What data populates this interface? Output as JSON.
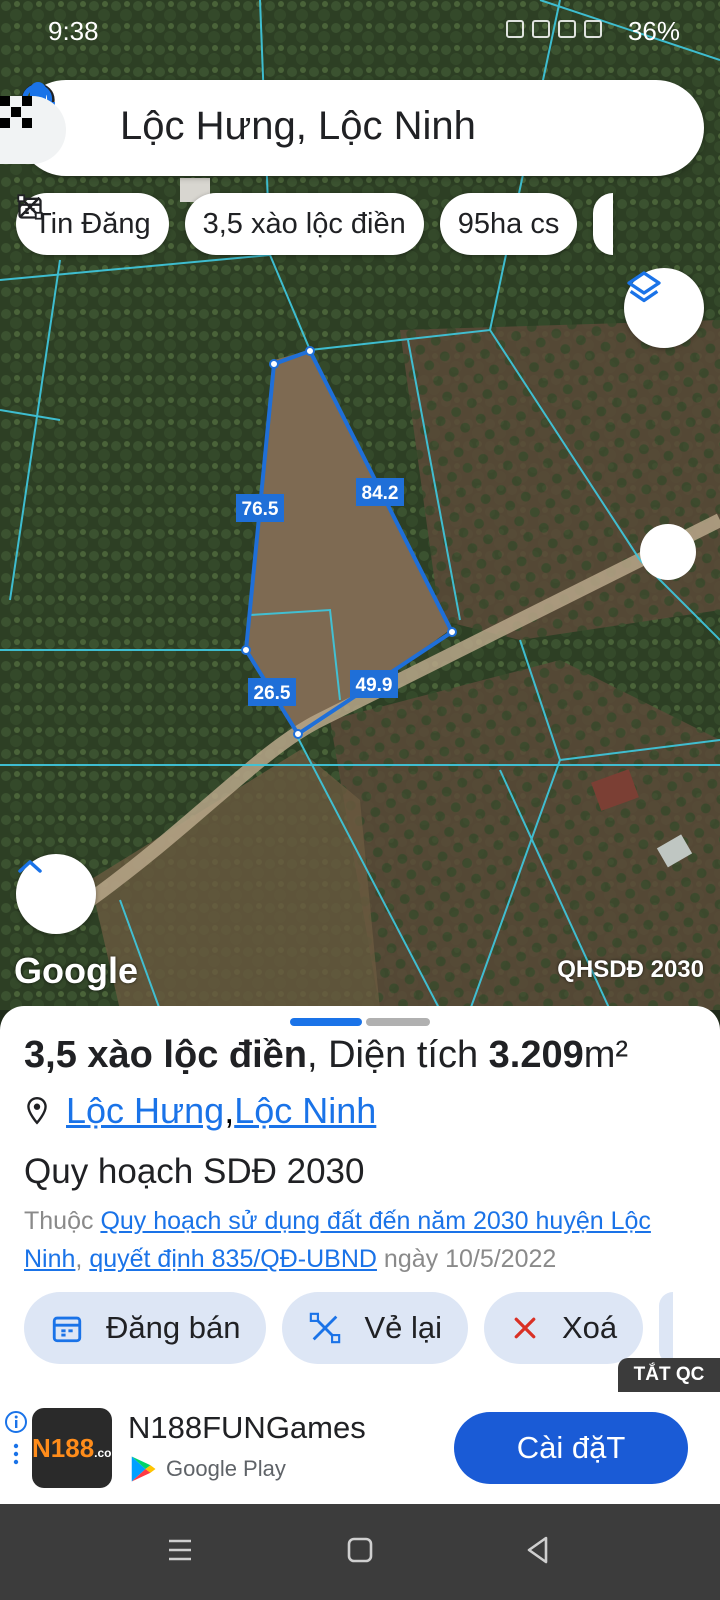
{
  "status_bar": {
    "time": "9:38",
    "battery": "36%"
  },
  "search": {
    "query": "Lộc Hưng, Lộc Ninh"
  },
  "chips": [
    {
      "label": "Tin Đăng",
      "icon": "calendar-icon"
    },
    {
      "label": "3,5 xào lộc điền",
      "icon": "draw-polygon-icon"
    },
    {
      "label": "95ha cs",
      "icon": "draw-polygon-icon"
    }
  ],
  "map": {
    "plot_edge_labels": [
      "76.5",
      "84.2",
      "26.5",
      "49.9"
    ],
    "google_logo": "Google",
    "plan_label": "QHSDĐ 2030",
    "colors": {
      "parcel_lines": "#3fc4d9",
      "selected_plot": "#1f6fd8"
    }
  },
  "listing": {
    "name": "3,5 xào lộc điền",
    "area_prefix": ", Diện tích ",
    "area_value": "3.209",
    "area_unit": "m²",
    "location_commune": "Lộc Hưng",
    "location_sep": ", ",
    "location_district": "Lộc Ninh",
    "plan_title": "Quy hoạch SDĐ 2030",
    "plan_prefix": "Thuộc ",
    "plan_link": "Quy hoạch sử dụng đất đến năm 2030 huyện Lộc Ninh",
    "plan_comma": ", ",
    "decision_link": "quyết định 835/QĐ-UBND",
    "decision_date": " ngày 10/5/2022"
  },
  "actions": [
    {
      "label": "Đăng bán",
      "icon": "calendar-icon"
    },
    {
      "label": "Vẻ lại",
      "icon": "draw-polygon-icon"
    },
    {
      "label": "Xoá",
      "icon": "close-icon"
    }
  ],
  "ad": {
    "off_tag": "TẮT QC",
    "logo_text": "N188",
    "logo_sub": ".com",
    "app_name": "N188FUNGames",
    "store": "Google Play",
    "install_label": "Cài đặT",
    "colors": {
      "install": "#1a5bd6"
    }
  }
}
